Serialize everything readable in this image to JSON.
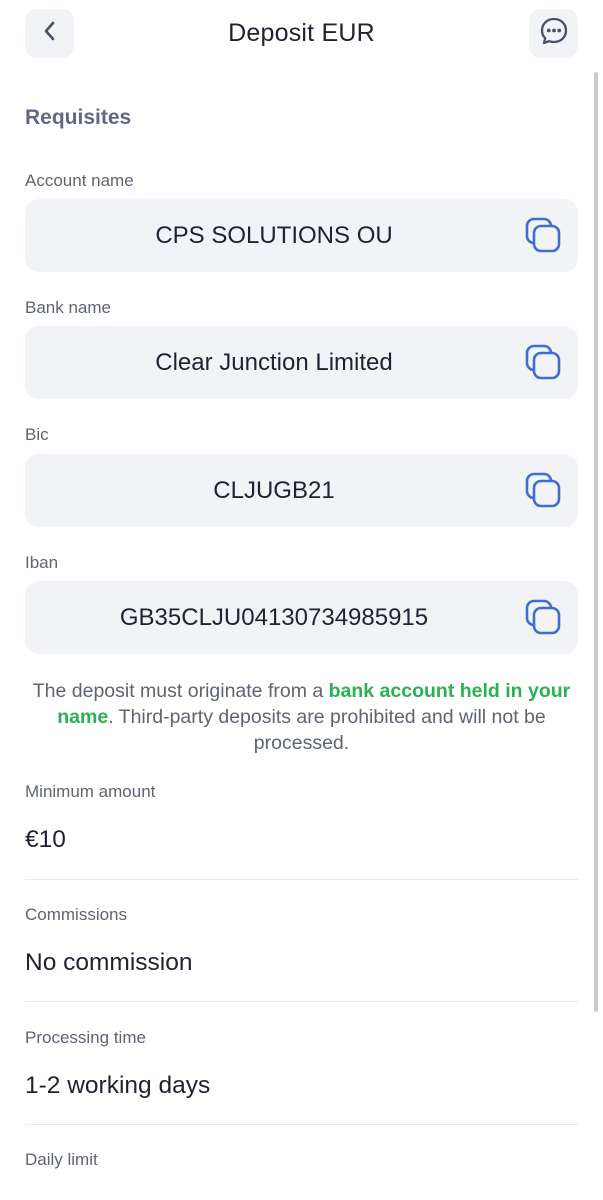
{
  "header": {
    "title": "Deposit EUR",
    "back_icon": "chevron-left-icon",
    "chat_icon": "chat-bubble-icon"
  },
  "requisites": {
    "heading": "Requisites",
    "fields": [
      {
        "label": "Account name",
        "value": "CPS SOLUTIONS OU"
      },
      {
        "label": "Bank name",
        "value": "Clear Junction Limited"
      },
      {
        "label": "Bic",
        "value": "CLJUGB21"
      },
      {
        "label": "Iban",
        "value": "GB35CLJU04130734985915"
      }
    ],
    "copy_icon": "copy-icon"
  },
  "notice": {
    "before": "The deposit must originate from a ",
    "highlight": "bank account held in your name",
    "after": ". Third-party deposits are prohibited and will not be processed."
  },
  "info": [
    {
      "label": "Minimum amount",
      "value": "€10"
    },
    {
      "label": "Commissions",
      "value": "No commission"
    },
    {
      "label": "Processing time",
      "value": "1-2 working days"
    },
    {
      "label": "Daily limit",
      "value": ""
    }
  ],
  "colors": {
    "accent_blue": "#3f6fce",
    "highlight_green": "#2bb153",
    "field_bg": "#f2f3f7"
  }
}
